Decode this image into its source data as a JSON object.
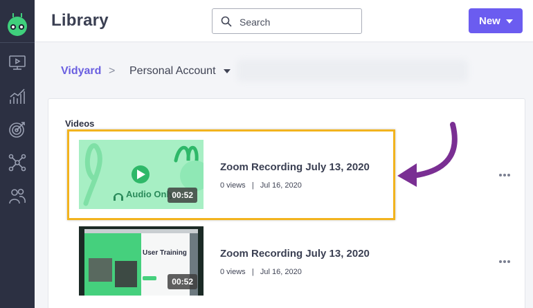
{
  "header": {
    "title": "Library",
    "search_placeholder": "Search",
    "new_label": "New"
  },
  "breadcrumb": {
    "root": "Vidyard",
    "separator": ">",
    "current": "Personal Account"
  },
  "section": {
    "title": "Videos"
  },
  "videos": [
    {
      "title": "Zoom Recording July 13, 2020",
      "views": "0 views",
      "date": "Jul 16, 2020",
      "duration": "00:52",
      "thumb_label": "Audio Only",
      "highlighted": true
    },
    {
      "title": "Zoom Recording July 13, 2020",
      "views": "0 views",
      "date": "Jul 16, 2020",
      "duration": "00:52",
      "thumb_label": "User Training"
    }
  ],
  "sidebar": {
    "items": [
      "videos-icon",
      "analytics-icon",
      "target-icon",
      "network-icon",
      "users-icon"
    ]
  },
  "colors": {
    "accent": "#6b5cf0",
    "sidebar": "#2c3042",
    "highlight": "#f2b31e",
    "arrow": "#7a2f93",
    "thumb_green": "#a7efc4"
  }
}
